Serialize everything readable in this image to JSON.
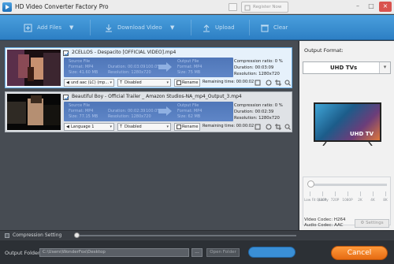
{
  "window": {
    "title": "HD Video Converter Factory Pro",
    "register_label": "Register Now"
  },
  "toolbar": {
    "add_files": "Add Files",
    "download_video": "Download Video",
    "upload": "Upload",
    "clear": "Clear"
  },
  "tasks": [
    {
      "file_name": "2CELLOS - Despacito [OFFICIAL VIDEO].mp4",
      "src_label": "Source File",
      "src_format": "Format: MP4",
      "src_duration": "Duration: 00:03:09",
      "src_size": "Size: 41.60 MB",
      "src_resolution": "Resolution: 1280x720",
      "percent": "100.0%",
      "out_label": "Output File",
      "out_format": "Format: MP4",
      "out_size": "Size: 75 MB",
      "compression": "Compression ratio: 0 %",
      "duration": "Duration: 00:03:09",
      "resolution": "Resolution: 1280x720",
      "audio": "und aac (LC) (mp...",
      "subtitle": "Disabled",
      "rename": "Rename",
      "remaining": "Remaining time: 00:00:02"
    },
    {
      "file_name": "Beautiful Boy - Official Trailer _ Amazon Studios-NA_mp4_Output_3.mp4",
      "src_label": "Source File",
      "src_format": "Format: MP4",
      "src_duration": "Duration: 00:02:39",
      "src_size": "Size: 77.15 MB",
      "src_resolution": "Resolution: 1280x720",
      "percent": "100.0%",
      "out_label": "Output File",
      "out_format": "Format: MP4",
      "out_size": "Size: 62 MB",
      "compression": "Compression ratio: 0 %",
      "duration": "Duration: 00:02:39",
      "resolution": "Resolution: 1280x720",
      "audio": "Language 1",
      "subtitle": "Disabled",
      "rename": "Rename",
      "remaining": "Remaining time: 00:00:02"
    }
  ],
  "compression": {
    "label": "Compression Setting"
  },
  "bottom": {
    "output_folder_label": "Output Folder:",
    "output_folder_path": "C:\\Users\\WonderFox\\Desktop",
    "browse": "...",
    "open_folder": "Open Folder",
    "cancel": "Cancel"
  },
  "right": {
    "output_format_label": "Output Format:",
    "format_value": "UHD TVs",
    "tv_brand_label": "UHD TV",
    "quality_labels": [
      "Low Fit Quality",
      "480P",
      "720P",
      "1080P",
      "2K",
      "4K",
      "8K"
    ],
    "video_codec": "Video Codec: H264",
    "audio_codec": "Audio Codec: AAC",
    "settings": "Settings"
  },
  "colors": {
    "toolbar": "#2d7fc4",
    "cancel": "#f07a1e",
    "info_block": "#5a80c2"
  }
}
